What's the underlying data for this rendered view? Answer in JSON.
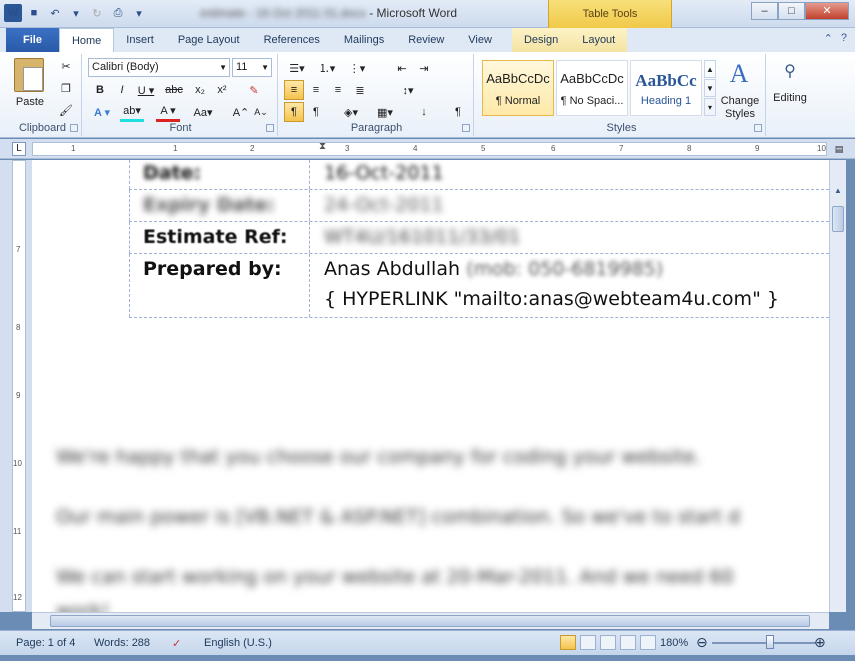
{
  "window": {
    "title_blurred": "estimate - 16 Oct 2011 01.docx",
    "separator": " - ",
    "app_name": "Microsoft Word",
    "context_tab_group": "Table Tools"
  },
  "tabs": [
    "File",
    "Home",
    "Insert",
    "Page Layout",
    "References",
    "Mailings",
    "Review",
    "View",
    "Design",
    "Layout"
  ],
  "ribbon": {
    "clipboard": {
      "label": "Clipboard",
      "paste": "Paste"
    },
    "font": {
      "label": "Font",
      "font_name": "Calibri (Body)",
      "font_size": "11"
    },
    "paragraph": {
      "label": "Paragraph"
    },
    "styles": {
      "label": "Styles",
      "items": [
        {
          "sample": "AaBbCcDc",
          "name": "¶ Normal"
        },
        {
          "sample": "AaBbCcDc",
          "name": "¶ No Spaci..."
        },
        {
          "sample": "AaBbCc",
          "name": "Heading 1"
        }
      ],
      "change_styles": "Change Styles"
    },
    "editing": {
      "label": "Editing"
    }
  },
  "ruler_numbers": [
    "1",
    "1",
    "2",
    "3",
    "4",
    "5",
    "6",
    "7",
    "8",
    "9",
    "10"
  ],
  "vruler_numbers": [
    "7",
    "8",
    "9",
    "10",
    "11",
    "12"
  ],
  "document": {
    "rows": [
      {
        "label": "Date:",
        "value": "16-Oct-2011",
        "blurred": true
      },
      {
        "label": "Expiry Date:",
        "value": "24-Oct-2011",
        "blurred": true
      },
      {
        "label": "Estimate Ref:",
        "value": "WT4U/161011/33/01",
        "blurred": true
      },
      {
        "label": "Prepared by:",
        "value": "Anas Abdullah",
        "value_blurred": "(mob: 050-6819985)",
        "value2": "{ HYPERLINK \"mailto:anas@webteam4u.com\"  }"
      }
    ],
    "paragraphs": [
      "We're happy that you choose our company for coding your website.",
      "Our main power is [VB.NET & ASP.NET] combination. So we've to start d",
      "We can start working on your website at 20-Mar-2011. And we need 60",
      "work!"
    ]
  },
  "status": {
    "page": "Page: 1 of 4",
    "words": "Words: 288",
    "language": "English (U.S.)",
    "zoom": "180%"
  },
  "colors": {
    "accent": "#2b5797",
    "context_tab": "#f1c94a"
  }
}
